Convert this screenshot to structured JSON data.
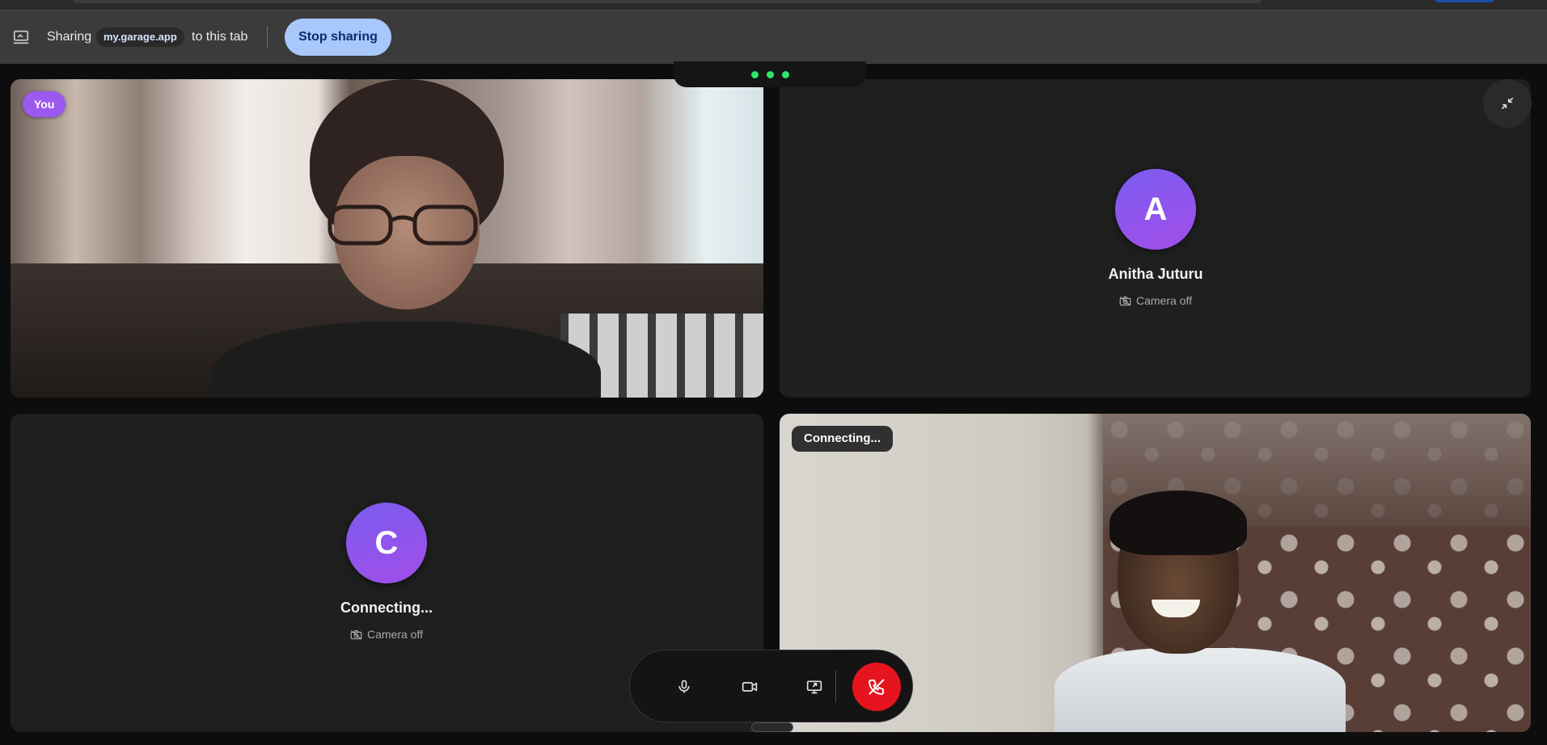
{
  "share_bar": {
    "prefix": "Sharing",
    "domain": "my.garage.app",
    "suffix": "to this tab",
    "stop_label": "Stop sharing"
  },
  "tiles": {
    "self": {
      "badge": "You"
    },
    "anitha": {
      "initial": "A",
      "name": "Anitha Juturu",
      "camera_status": "Camera off"
    },
    "c": {
      "initial": "C",
      "name": "Connecting...",
      "camera_status": "Camera off"
    },
    "remote": {
      "badge": "Connecting..."
    }
  },
  "indicator": {
    "dot_color": "#2ee86a"
  },
  "controls": {
    "mic_icon": "mic-icon",
    "camera_icon": "video-camera-icon",
    "share_icon": "screen-share-icon",
    "end_icon": "phone-hangup-icon",
    "end_color": "#e5141e"
  },
  "colors": {
    "accent": "#a8c7fa",
    "avatar_gradient_start": "#7b5cf0",
    "avatar_gradient_end": "#a24ee8",
    "you_badge": "#9b59f0"
  }
}
